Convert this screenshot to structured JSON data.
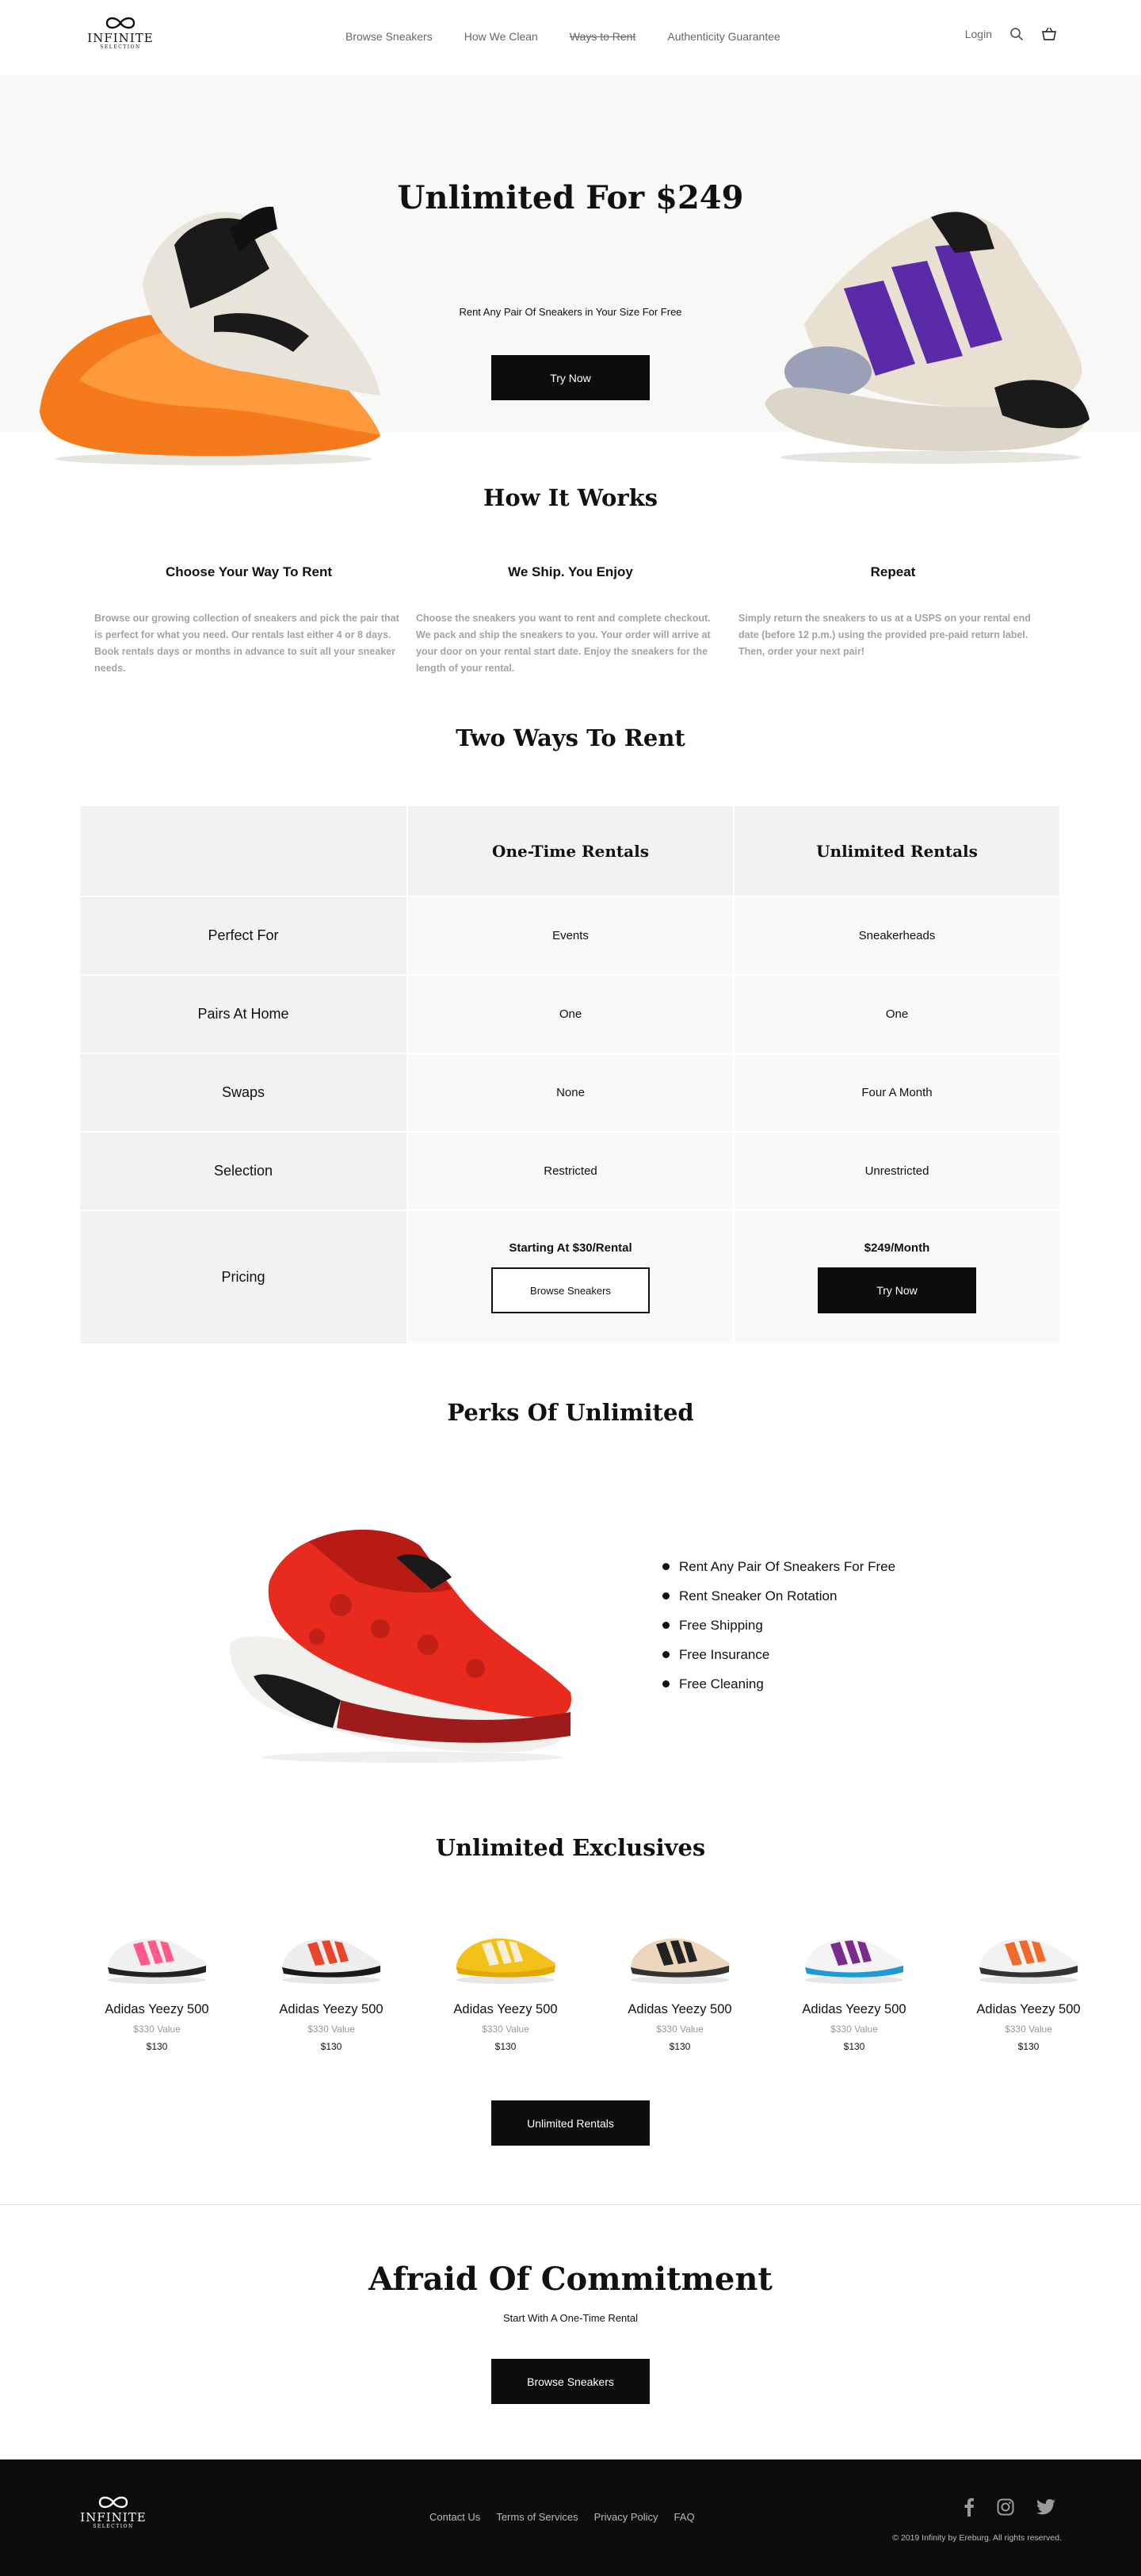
{
  "header": {
    "logo_line1": "INFINITE",
    "logo_line2": "SELECTION",
    "nav": [
      "Browse Sneakers",
      "How We Clean",
      "Ways to Rent",
      "Authenticity Guarantee"
    ],
    "login": "Login",
    "icons": [
      "search-icon",
      "basket-icon"
    ]
  },
  "hero": {
    "title": "Unlimited For $249",
    "subtitle": "Rent Any Pair Of Sneakers in Your Size For Free",
    "cta": "Try Now"
  },
  "how": {
    "title": "How It Works",
    "steps": [
      {
        "title": "Choose Your Way To Rent",
        "text": "Browse our growing collection of sneakers and pick the pair that is perfect for what you need. Our rentals last either 4 or 8 days. Book rentals days or months in advance to suit all your sneaker needs."
      },
      {
        "title": "We Ship. You Enjoy",
        "text": "Choose the sneakers you want to rent and complete checkout. We pack and ship the sneakers to you. Your order will arrive at your door on your rental start date. Enjoy the sneakers for the length of your rental."
      },
      {
        "title": "Repeat",
        "text": "Simply return the sneakers to us at a USPS on your rental end date (before 12 p.m.) using the provided pre-paid return label. Then, order your next pair!"
      }
    ]
  },
  "ways": {
    "title": "Two Ways To Rent",
    "columns": [
      "One-Time Rentals",
      "Unlimited Rentals"
    ],
    "rows": [
      {
        "label": "Perfect For",
        "one": "Events",
        "unl": "Sneakerheads"
      },
      {
        "label": "Pairs At Home",
        "one": "One",
        "unl": "One"
      },
      {
        "label": "Swaps",
        "one": "None",
        "unl": "Four A Month"
      },
      {
        "label": "Selection",
        "one": "Restricted",
        "unl": "Unrestricted"
      }
    ],
    "pricing": {
      "label": "Pricing",
      "one": "Starting At $30/Rental",
      "one_btn": "Browse Sneakers",
      "unl": "$249/Month",
      "unl_btn": "Try Now"
    }
  },
  "perks": {
    "title": "Perks Of Unlimited",
    "items": [
      "Rent Any Pair Of Sneakers For Free",
      "Rent Sneaker On Rotation",
      "Free Shipping",
      "Free Insurance",
      "Free Cleaning"
    ]
  },
  "exclusives": {
    "title": "Unlimited Exclusives",
    "products": [
      {
        "name": "Adidas Yeezy 500",
        "value": "$330 Value",
        "price": "$130",
        "colors": [
          "#f0f0f0",
          "#ff5a8a",
          "#222"
        ]
      },
      {
        "name": "Adidas Yeezy 500",
        "value": "$330 Value",
        "price": "$130",
        "colors": [
          "#eeeeee",
          "#e8452c",
          "#1a1a1a"
        ]
      },
      {
        "name": "Adidas Yeezy 500",
        "value": "$330 Value",
        "price": "$130",
        "colors": [
          "#f3c21a",
          "#f7f0d8",
          "#e0a800"
        ]
      },
      {
        "name": "Adidas Yeezy 500",
        "value": "$330 Value",
        "price": "$130",
        "colors": [
          "#ecd7bd",
          "#222",
          "#333"
        ]
      },
      {
        "name": "Adidas Yeezy 500",
        "value": "$330 Value",
        "price": "$130",
        "colors": [
          "#f4f4f4",
          "#7a2c8c",
          "#1e9ad6"
        ]
      },
      {
        "name": "Adidas Yeezy 500",
        "value": "$330 Value",
        "price": "$130",
        "colors": [
          "#f2f2f2",
          "#f06a2a",
          "#333"
        ]
      }
    ],
    "cta": "Unlimited Rentals"
  },
  "commit": {
    "title": "Afraid Of Commitment",
    "subtitle": "Start With A One-Time Rental",
    "cta": "Browse Sneakers"
  },
  "footer": {
    "logo_line1": "INFINITE",
    "logo_line2": "SELECTION",
    "links": [
      "Contact Us",
      "Terms of Services",
      "Privacy Policy",
      "FAQ"
    ],
    "social": [
      "facebook-icon",
      "instagram-icon",
      "twitter-icon"
    ],
    "copyright": "© 2019 Infinity by Ereburg. All rights reserved."
  }
}
